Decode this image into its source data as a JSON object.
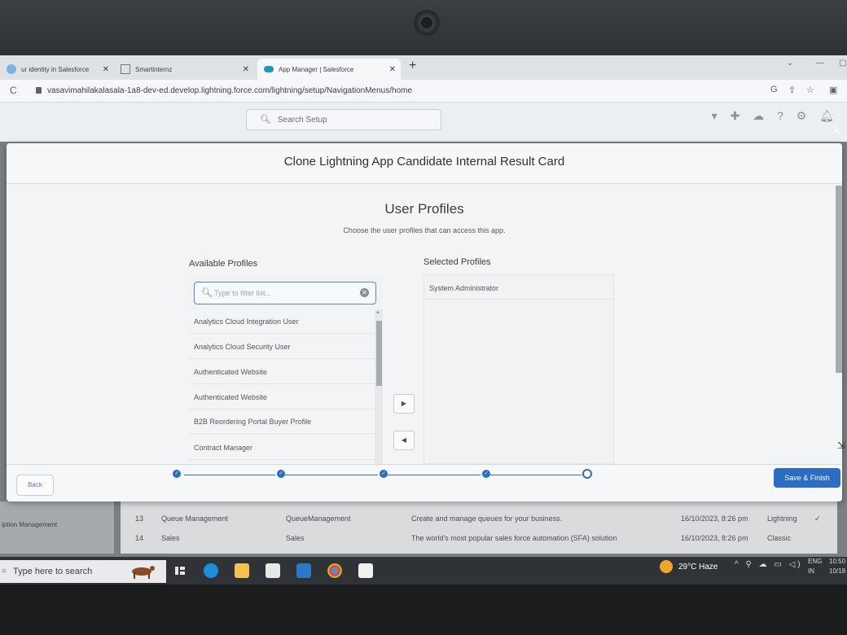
{
  "browser": {
    "tabs": [
      {
        "label": "ur identity in Salesforce",
        "active": false
      },
      {
        "label": "Smartinternz",
        "active": false
      },
      {
        "label": "App Manager | Salesforce",
        "active": true
      }
    ],
    "new_tab": "+",
    "url": "vasavimahilakalasala-1a8-dev-ed.develop.lightning.force.com/lightning/setup/NavigationMenus/home"
  },
  "sf_header": {
    "search_placeholder": "Search Setup"
  },
  "modal": {
    "title": "Clone Lightning App Candidate Internal Result Card",
    "section_title": "User Profiles",
    "section_subtitle": "Choose the user profiles that can access this app.",
    "available_label": "Available Profiles",
    "selected_label": "Selected Profiles",
    "filter_placeholder": "Type to filter list...",
    "available_profiles": [
      "Analytics Cloud Integration User",
      "Analytics Cloud Security User",
      "Authenticated Website",
      "Authenticated Website",
      "B2B Reordering Portal Buyer Profile",
      "Contract Manager"
    ],
    "selected_profiles": [
      "System Administrator"
    ],
    "add_button": "▶",
    "remove_button": "◀",
    "back_button": "Back",
    "save_button": "Save & Finish",
    "progress": {
      "steps": 5,
      "completed": 4,
      "current": 5
    }
  },
  "background_table": {
    "left_label": "iption Management",
    "rows": [
      {
        "num": "13",
        "name": "Queue Management",
        "dev_name": "QueueManagement",
        "description": "Create and manage queues for your business.",
        "modified": "16/10/2023, 8:26 pm",
        "type": "Lightning"
      },
      {
        "num": "14",
        "name": "Sales",
        "dev_name": "Sales",
        "description": "The world's most popular sales force automation (SFA) solution",
        "modified": "16/10/2023, 8:26 pm",
        "type": "Classic"
      }
    ]
  },
  "taskbar": {
    "search_text": "Type here to search",
    "weather": "29°C  Haze",
    "lang_line1": "ENG",
    "lang_line2": "IN",
    "time_line1": "10:50",
    "time_line2": "10/18"
  },
  "colors": {
    "brand_blue": "#2b6cc4",
    "progress_line": "#3a6fb8"
  }
}
